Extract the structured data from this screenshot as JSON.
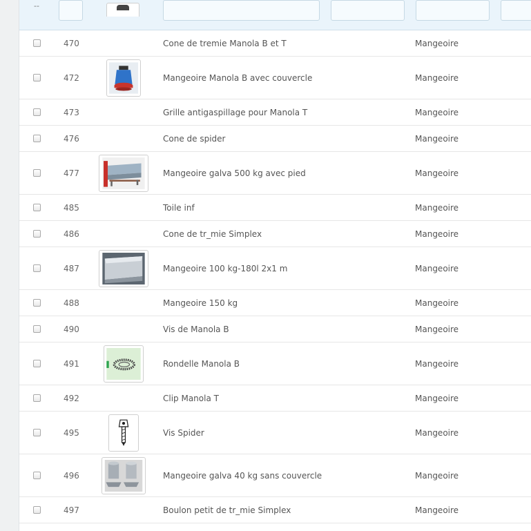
{
  "filters": {
    "checkbox_col": "--",
    "image_col": "--"
  },
  "rows": [
    {
      "id": "470",
      "name": "Cone de tremie Manola B et T",
      "category": "Mangeoire",
      "image": ""
    },
    {
      "id": "472",
      "name": "Mangeoire Manola B avec couvercle",
      "category": "Mangeoire",
      "image": "blue-feeder"
    },
    {
      "id": "473",
      "name": "Grille antigaspillage pour Manola T",
      "category": "Mangeoire",
      "image": ""
    },
    {
      "id": "476",
      "name": "Cone de spider",
      "category": "Mangeoire",
      "image": ""
    },
    {
      "id": "477",
      "name": "Mangeoire galva 500 kg avec pied",
      "category": "Mangeoire",
      "image": "galva-trough-stand"
    },
    {
      "id": "485",
      "name": "Toile inf",
      "category": "Mangeoire",
      "image": ""
    },
    {
      "id": "486",
      "name": "Cone de tr_mie Simplex",
      "category": "Mangeoire",
      "image": ""
    },
    {
      "id": "487",
      "name": "Mangeoire 100 kg-180l 2x1 m",
      "category": "Mangeoire",
      "image": "galva-trough"
    },
    {
      "id": "488",
      "name": "Mangeoire 150 kg",
      "category": "Mangeoire",
      "image": ""
    },
    {
      "id": "490",
      "name": "Vis de Manola B",
      "category": "Mangeoire",
      "image": ""
    },
    {
      "id": "491",
      "name": "Rondelle Manola B",
      "category": "Mangeoire",
      "image": "washer"
    },
    {
      "id": "492",
      "name": "Clip Manola T",
      "category": "Mangeoire",
      "image": ""
    },
    {
      "id": "495",
      "name": "Vis Spider",
      "category": "Mangeoire",
      "image": "screw"
    },
    {
      "id": "496",
      "name": "Mangeoire galva 40 kg sans couvercle",
      "category": "Mangeoire",
      "image": "galva-feeders"
    },
    {
      "id": "497",
      "name": "Boulon petit de tr_mie Simplex",
      "category": "Mangeoire",
      "image": ""
    }
  ]
}
